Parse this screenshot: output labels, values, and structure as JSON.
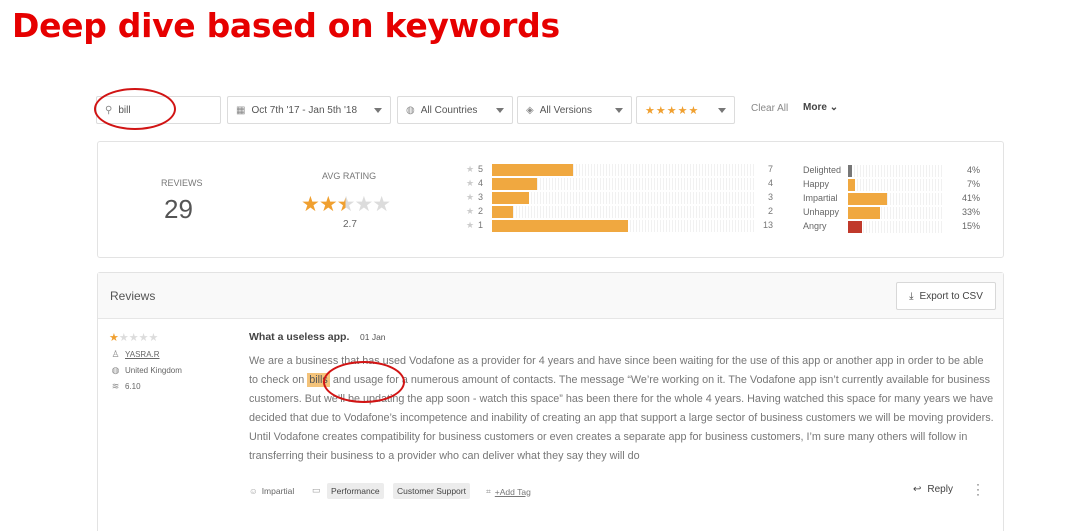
{
  "slide": {
    "title": "Deep dive based on keywords"
  },
  "filters": {
    "search_value": "bill",
    "date_range": "Oct 7th '17 - Jan 5th '18",
    "countries": "All Countries",
    "versions": "All Versions",
    "rating_stars": "★★★★★",
    "clear_all": "Clear All",
    "more": "More"
  },
  "stats": {
    "reviews_label": "REVIEWS",
    "reviews_count": "29",
    "avg_label": "AVG RATING",
    "avg_value": "2.7",
    "avg_stars_filled": 2.5,
    "histogram": [
      {
        "stars": "5",
        "count": "7",
        "share": 0.31
      },
      {
        "stars": "4",
        "count": "4",
        "share": 0.17
      },
      {
        "stars": "3",
        "count": "3",
        "share": 0.14
      },
      {
        "stars": "2",
        "count": "2",
        "share": 0.08
      },
      {
        "stars": "1",
        "count": "13",
        "share": 0.52
      }
    ],
    "sentiment": [
      {
        "label": "Delighted",
        "pct": "4%",
        "share": 0.04,
        "color": "#777777"
      },
      {
        "label": "Happy",
        "pct": "7%",
        "share": 0.07,
        "color": "#f0a840"
      },
      {
        "label": "Impartial",
        "pct": "41%",
        "share": 0.41,
        "color": "#f0a840"
      },
      {
        "label": "Unhappy",
        "pct": "33%",
        "share": 0.33,
        "color": "#f0a840"
      },
      {
        "label": "Angry",
        "pct": "15%",
        "share": 0.15,
        "color": "#c0392b"
      }
    ]
  },
  "reviews_panel": {
    "title": "Reviews",
    "export_label": "Export to CSV"
  },
  "review": {
    "stars": 1,
    "user": "YASRA.R",
    "country": "United Kingdom",
    "version": "6.10",
    "title": "What a useless app.",
    "date": "01 Jan",
    "body_before": "We are a business that has used Vodafone as a provider for 4 years and have since been waiting for the use of this app or another app in order to be able to check on ",
    "body_highlight": "bills",
    "body_after": " and usage for a numerous amount of contacts. The message “We’re working on it. The Vodafone app isn’t currently available for business customers. But we’ll be updating the app soon - watch this space” has been there for the whole 4 years. Having watched this space for many years we have decided that due to Vodafone’s incompetence and inability of creating an app that support a large sector of business customers we will be moving providers. Until Vodafone creates compatibility for business customers or even creates a separate app for business customers, I’m sure many others will follow in transferring their business to a provider who can deliver what they say they will do",
    "sentiment": "Impartial",
    "tags": [
      "Performance",
      "Customer Support"
    ],
    "add_tag": "+Add Tag",
    "reply": "Reply"
  }
}
